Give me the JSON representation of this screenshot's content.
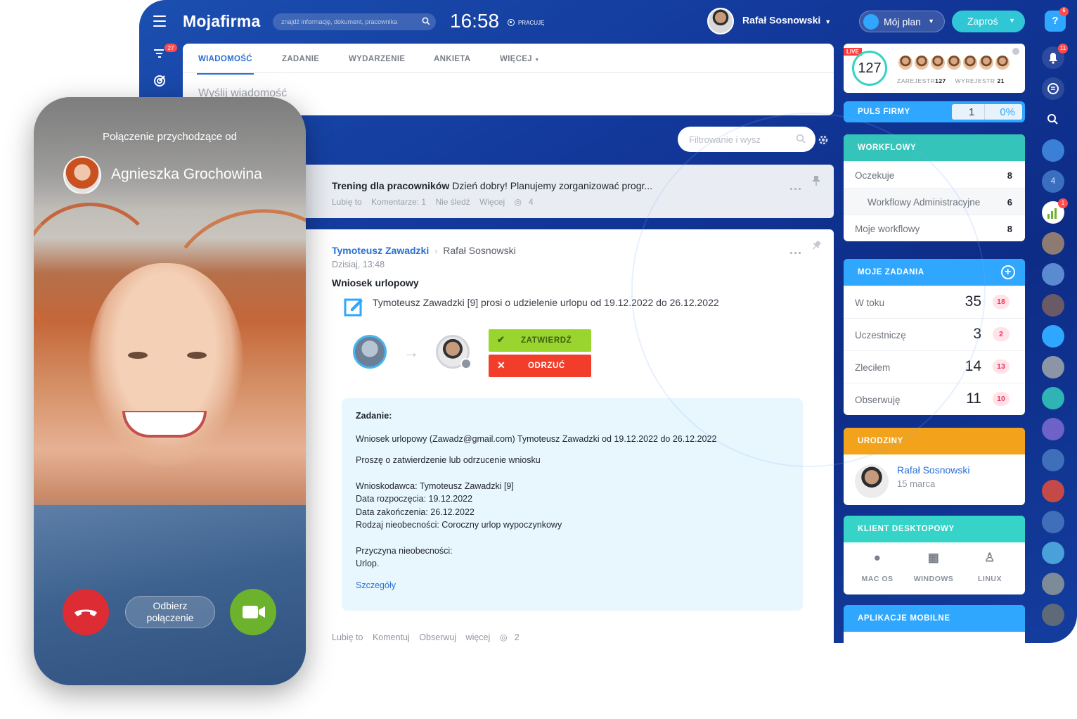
{
  "app": {
    "brand": "Mojafirma",
    "search_placeholder": "znajdź informację, dokument, pracownika",
    "clock": "16:58",
    "status": "PRACUJĘ",
    "user_name": "Rafał Sosnowski",
    "plan_label": "Mój plan",
    "invite_label": "Zaproś",
    "help_badge": "6",
    "filter_badge": "27"
  },
  "composer": {
    "tabs": [
      "WIADOMOŚĆ",
      "ZADANIE",
      "WYDARZENIE",
      "ANKIETA",
      "WIĘCEJ"
    ],
    "placeholder": "Wyślij wiadomość"
  },
  "feed": {
    "filter_placeholder": "Filtrowanie i wysz",
    "post1": {
      "title": "Trening dla pracowników",
      "text": "Dzień dobry! Planujemy zorganizować progr...",
      "actions": [
        "Lubię to",
        "Komentarze: 1",
        "Nie śledź",
        "Więcej"
      ],
      "views": "4"
    },
    "post2": {
      "author": "Tymoteusz Zawadzki",
      "recipient": "Rafał Sosnowski",
      "date": "Dzisiaj, 13:48",
      "heading": "Wniosek urlopowy",
      "request": "Tymoteusz Zawadzki [9] prosi o udzielenie urlopu od 19.12.2022 do 26.12.2022",
      "approve": "ZATWIERDŹ",
      "reject": "ODRZUĆ",
      "task_title": "Zadanie:",
      "task_line1": "Wniosek urlopowy (Zawadz@gmail.com) Tymoteusz Zawadzki od 19.12.2022 do 26.12.2022",
      "task_line2": "Proszę o zatwierdzenie lub odrzucenie wniosku",
      "task_line3": "Wnioskodawca: Tymoteusz Zawadzki [9]",
      "task_line4": "Data rozpoczęcia: 19.12.2022",
      "task_line5": "Data zakończenia: 26.12.2022",
      "task_line6": "Rodzaj nieobecności: Coroczny urlop wypoczynkowy",
      "task_line7": "Przyczyna nieobecności:",
      "task_line8": "Urlop.",
      "details": "Szczegóły",
      "actions": [
        "Lubię to",
        "Komentuj",
        "Obserwuj",
        "więcej"
      ],
      "views": "2"
    }
  },
  "widgets": {
    "live": {
      "tag": "LIVE",
      "count": "127",
      "registered_label": "ZAREJESTR",
      "registered": "127",
      "unregistered_label": "WYREJESTR",
      "unregistered": "21"
    },
    "puls": {
      "label": "PULS FIRMY",
      "value": "1",
      "percent": "0%"
    },
    "workflow": {
      "title": "WORKFLOWY",
      "rows": [
        {
          "label": "Oczekuje",
          "value": "8"
        },
        {
          "label": "Workflowy Administracyjne",
          "value": "6"
        },
        {
          "label": "Moje workflowy",
          "value": "8"
        }
      ]
    },
    "tasks": {
      "title": "MOJE ZADANIA",
      "rows": [
        {
          "label": "W toku",
          "value": "35",
          "badge": "18"
        },
        {
          "label": "Uczestniczę",
          "value": "3",
          "badge": "2"
        },
        {
          "label": "Zleciłem",
          "value": "14",
          "badge": "13"
        },
        {
          "label": "Obserwuję",
          "value": "11",
          "badge": "10"
        }
      ]
    },
    "birthday": {
      "title": "URODZINY",
      "name": "Rafał Sosnowski",
      "date": "15 marca"
    },
    "desktop": {
      "title": "KLIENT DESKTOPOWY",
      "items": [
        "MAC OS",
        "WINDOWS",
        "LINUX"
      ]
    },
    "mobile": {
      "title": "APLIKACJE MOBILNE"
    }
  },
  "rail": {
    "notif_badge": "11",
    "counter": "4",
    "chart_badge": "1"
  },
  "call": {
    "incoming": "Połączenie przychodzące od",
    "caller": "Agnieszka Grochowina",
    "answer_line1": "Odbierz",
    "answer_line2": "połączenie"
  }
}
